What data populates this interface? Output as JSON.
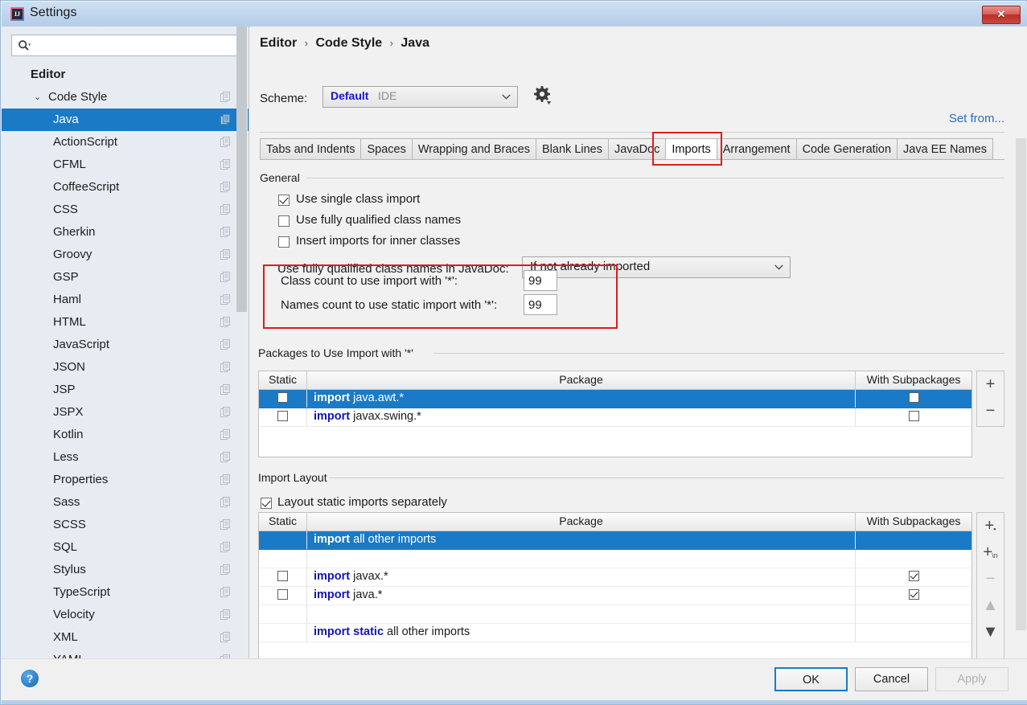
{
  "window": {
    "title": "Settings",
    "app_icon": "intellij-idea-icon",
    "close_label": "✕",
    "accent_selection": "#1a7ac6",
    "highlight_box_color": "#e01b1b",
    "keyword_color": "#1515b0",
    "link_color": "#2a6fba"
  },
  "sidebar": {
    "search": {
      "value": "",
      "placeholder": ""
    },
    "items": [
      {
        "label": "Editor",
        "level": "header",
        "chevron": "",
        "copy_icon": false,
        "selected": false
      },
      {
        "label": "Code Style",
        "level": "lvl1",
        "chevron": "⌄",
        "copy_icon": true,
        "selected": false
      },
      {
        "label": "Java",
        "level": "lvl2",
        "chevron": "",
        "copy_icon": true,
        "selected": true
      },
      {
        "label": "ActionScript",
        "level": "lvl2",
        "chevron": "",
        "copy_icon": true,
        "selected": false
      },
      {
        "label": "CFML",
        "level": "lvl2",
        "chevron": "",
        "copy_icon": true,
        "selected": false
      },
      {
        "label": "CoffeeScript",
        "level": "lvl2",
        "chevron": "",
        "copy_icon": true,
        "selected": false
      },
      {
        "label": "CSS",
        "level": "lvl2",
        "chevron": "",
        "copy_icon": true,
        "selected": false
      },
      {
        "label": "Gherkin",
        "level": "lvl2",
        "chevron": "",
        "copy_icon": true,
        "selected": false
      },
      {
        "label": "Groovy",
        "level": "lvl2",
        "chevron": "",
        "copy_icon": true,
        "selected": false
      },
      {
        "label": "GSP",
        "level": "lvl2",
        "chevron": "",
        "copy_icon": true,
        "selected": false
      },
      {
        "label": "Haml",
        "level": "lvl2",
        "chevron": "",
        "copy_icon": true,
        "selected": false
      },
      {
        "label": "HTML",
        "level": "lvl2",
        "chevron": "",
        "copy_icon": true,
        "selected": false
      },
      {
        "label": "JavaScript",
        "level": "lvl2",
        "chevron": "",
        "copy_icon": true,
        "selected": false
      },
      {
        "label": "JSON",
        "level": "lvl2",
        "chevron": "",
        "copy_icon": true,
        "selected": false
      },
      {
        "label": "JSP",
        "level": "lvl2",
        "chevron": "",
        "copy_icon": true,
        "selected": false
      },
      {
        "label": "JSPX",
        "level": "lvl2",
        "chevron": "",
        "copy_icon": true,
        "selected": false
      },
      {
        "label": "Kotlin",
        "level": "lvl2",
        "chevron": "",
        "copy_icon": true,
        "selected": false
      },
      {
        "label": "Less",
        "level": "lvl2",
        "chevron": "",
        "copy_icon": true,
        "selected": false
      },
      {
        "label": "Properties",
        "level": "lvl2",
        "chevron": "",
        "copy_icon": true,
        "selected": false
      },
      {
        "label": "Sass",
        "level": "lvl2",
        "chevron": "",
        "copy_icon": true,
        "selected": false
      },
      {
        "label": "SCSS",
        "level": "lvl2",
        "chevron": "",
        "copy_icon": true,
        "selected": false
      },
      {
        "label": "SQL",
        "level": "lvl2",
        "chevron": "",
        "copy_icon": true,
        "selected": false
      },
      {
        "label": "Stylus",
        "level": "lvl2",
        "chevron": "",
        "copy_icon": true,
        "selected": false
      },
      {
        "label": "TypeScript",
        "level": "lvl2",
        "chevron": "",
        "copy_icon": true,
        "selected": false
      },
      {
        "label": "Velocity",
        "level": "lvl2",
        "chevron": "",
        "copy_icon": true,
        "selected": false
      },
      {
        "label": "XML",
        "level": "lvl2",
        "chevron": "",
        "copy_icon": true,
        "selected": false
      },
      {
        "label": "YAML",
        "level": "lvl2",
        "chevron": "",
        "copy_icon": true,
        "selected": false
      }
    ]
  },
  "header": {
    "breadcrumb": [
      "Editor",
      "Code Style",
      "Java"
    ],
    "breadcrumb_separator": "›",
    "scheme_label": "Scheme:",
    "scheme_value": "Default",
    "scheme_scope": "IDE",
    "gear_icon": "gear-icon",
    "set_from_label": "Set from..."
  },
  "tabs": [
    {
      "label": "Tabs and Indents",
      "active": false
    },
    {
      "label": "Spaces",
      "active": false
    },
    {
      "label": "Wrapping and Braces",
      "active": false
    },
    {
      "label": "Blank Lines",
      "active": false
    },
    {
      "label": "JavaDoc",
      "active": false
    },
    {
      "label": "Imports",
      "active": true
    },
    {
      "label": "Arrangement",
      "active": false
    },
    {
      "label": "Code Generation",
      "active": false
    },
    {
      "label": "Java EE Names",
      "active": false
    }
  ],
  "general": {
    "title": "General",
    "checkboxes": [
      {
        "label": "Use single class import",
        "checked": true
      },
      {
        "label": "Use fully qualified class names",
        "checked": false
      },
      {
        "label": "Insert imports for inner classes",
        "checked": false
      }
    ],
    "javadoc_label": "Use fully qualified class names in JavaDoc:",
    "javadoc_value": "If not already imported",
    "counts": [
      {
        "label": "Class count to use import with '*':",
        "value": "99"
      },
      {
        "label": "Names count to use static import with '*':",
        "value": "99"
      }
    ]
  },
  "packages_section": {
    "title": "Packages to Use Import with '*'",
    "columns": [
      "Static",
      "Package",
      "With Subpackages"
    ],
    "rows": [
      {
        "static": false,
        "keyword": "import",
        "package": "java.awt.*",
        "with_subpackages": false,
        "selected": true,
        "show_static_cb": true,
        "show_sub_cb": true
      },
      {
        "static": false,
        "keyword": "import",
        "package": "javax.swing.*",
        "with_subpackages": false,
        "selected": false,
        "show_static_cb": true,
        "show_sub_cb": true
      }
    ],
    "buttons": [
      {
        "name": "add-button",
        "glyph": "+",
        "disabled": false
      },
      {
        "name": "remove-button",
        "glyph": "−",
        "disabled": false
      }
    ]
  },
  "import_layout_section": {
    "title": "Import Layout",
    "layout_static_label": "Layout static imports separately",
    "layout_static_checked": true,
    "columns": [
      "Static",
      "Package",
      "With Subpackages"
    ],
    "rows": [
      {
        "keyword": "import",
        "package": "all other imports",
        "static": false,
        "with_subpackages": false,
        "selected": true,
        "show_static_cb": false,
        "show_sub_cb": false,
        "blank": false
      },
      {
        "keyword": "",
        "package": "<blank line>",
        "static": false,
        "with_subpackages": false,
        "selected": false,
        "show_static_cb": false,
        "show_sub_cb": false,
        "blank": true
      },
      {
        "keyword": "import",
        "package": "javax.*",
        "static": false,
        "with_subpackages": true,
        "selected": false,
        "show_static_cb": true,
        "show_sub_cb": true,
        "blank": false
      },
      {
        "keyword": "import",
        "package": "java.*",
        "static": false,
        "with_subpackages": true,
        "selected": false,
        "show_static_cb": true,
        "show_sub_cb": true,
        "blank": false
      },
      {
        "keyword": "",
        "package": "<blank line>",
        "static": false,
        "with_subpackages": false,
        "selected": false,
        "show_static_cb": false,
        "show_sub_cb": false,
        "blank": true
      },
      {
        "keyword": "import static",
        "package": "all other imports",
        "static": false,
        "with_subpackages": false,
        "selected": false,
        "show_static_cb": false,
        "show_sub_cb": false,
        "blank": false
      }
    ],
    "buttons": [
      {
        "name": "add-package-button",
        "glyph": "+",
        "sub": "▪",
        "disabled": false
      },
      {
        "name": "add-blank-line-button",
        "glyph": "+",
        "sub": "\\n",
        "disabled": false
      },
      {
        "name": "remove-button",
        "glyph": "−",
        "sub": "",
        "disabled": true
      },
      {
        "name": "move-up-button",
        "glyph": "▲",
        "sub": "",
        "disabled": true
      },
      {
        "name": "move-down-button",
        "glyph": "▼",
        "sub": "",
        "disabled": false
      }
    ]
  },
  "footer": {
    "help_label": "?",
    "ok_label": "OK",
    "cancel_label": "Cancel",
    "apply_label": "Apply",
    "apply_disabled": true
  }
}
